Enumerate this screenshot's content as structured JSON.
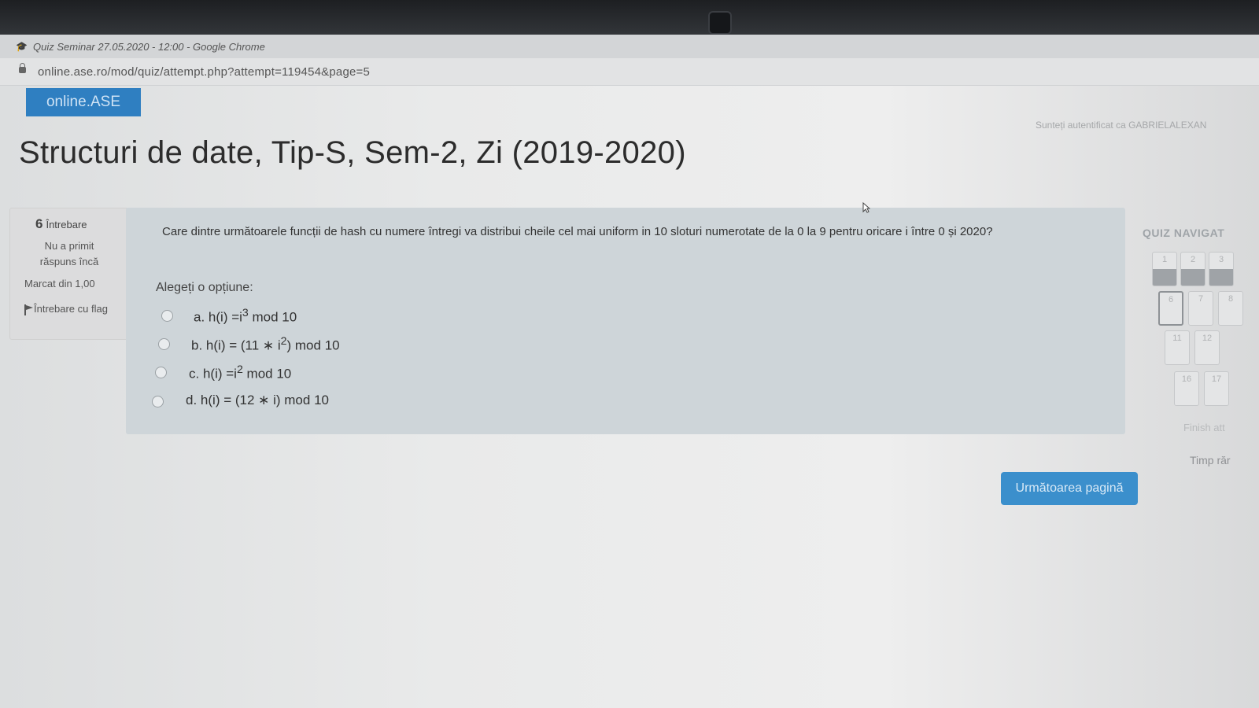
{
  "browser": {
    "window_title": "Quiz Seminar 27.05.2020 - 12:00 - Google Chrome",
    "url": "online.ase.ro/mod/quiz/attempt.php?attempt=119454&page=5"
  },
  "site": {
    "brand": "online.ASE",
    "logged_in_text": "Sunteți autentificat ca GABRIELALEXAN"
  },
  "course": {
    "title": "Structuri de date, Tip-S, Sem-2, Zi (2019-2020)"
  },
  "question_info": {
    "number": "6",
    "label": "Întrebare",
    "state": "Nu a primit răspuns încă",
    "grade": "Marcat din 1,00",
    "flag_label": "Întrebare cu flag"
  },
  "question": {
    "text": "Care dintre următoarele funcții de hash cu numere întregi va distribui cheile cel mai uniform in 10 sloturi numerotate de la 0 la 9 pentru oricare i între 0 și 2020?",
    "prompt": "Alegeți o opțiune:",
    "options": [
      {
        "letter": "a.",
        "pre": "h(i) =i",
        "sup": "3",
        "post": " mod 10"
      },
      {
        "letter": "b.",
        "pre": "h(i) = (11 ∗ i",
        "sup": "2",
        "post": ") mod 10"
      },
      {
        "letter": "c.",
        "pre": "h(i) =i",
        "sup": "2",
        "post": " mod 10"
      },
      {
        "letter": "d.",
        "pre": "h(i) = (12 ∗ i) mod 10",
        "sup": "",
        "post": ""
      }
    ]
  },
  "quiz_nav": {
    "title": "QUIZ NAVIGAT",
    "buttons": [
      "1",
      "2",
      "3",
      "6",
      "7",
      "8",
      "11",
      "12",
      "16",
      "17"
    ],
    "finish_label": "Finish att",
    "timer_label": "Timp răr"
  },
  "next_button": "Următoarea pagină"
}
